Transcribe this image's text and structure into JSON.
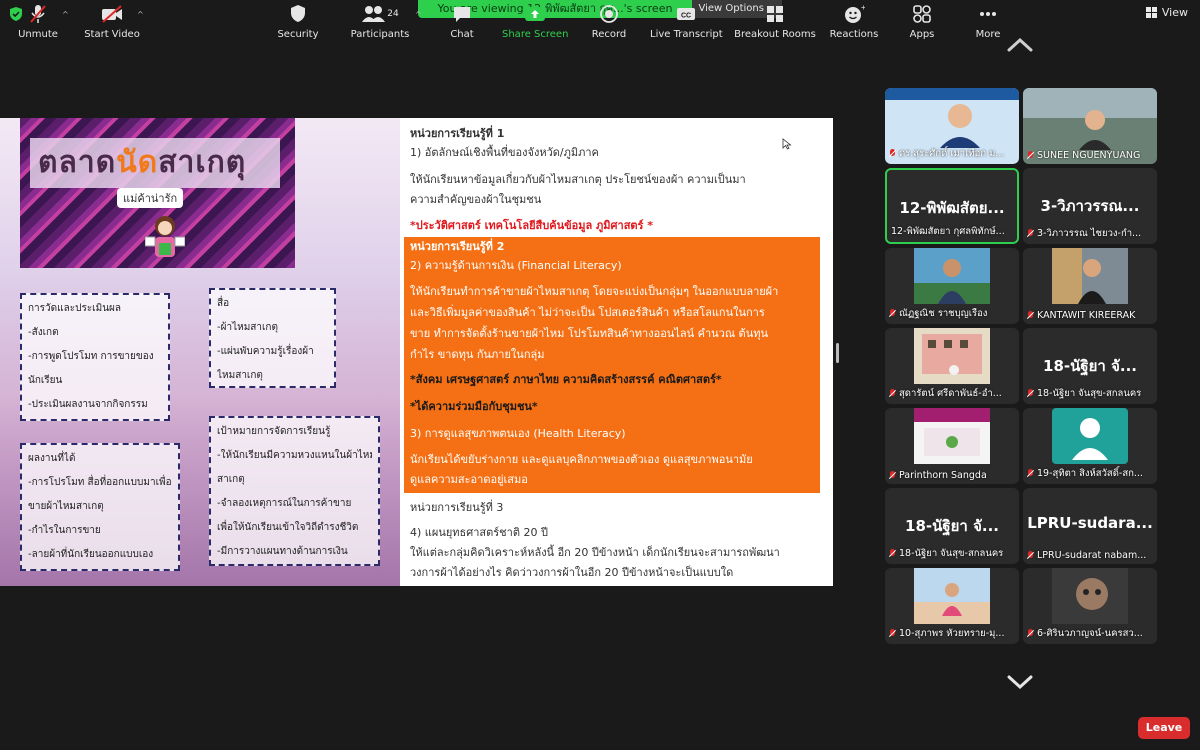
{
  "top": {
    "banner": "You are viewing 12-พิพัฒสัตยา กุศ...'s screen",
    "view_options": "View Options ⌄",
    "view_label": "View"
  },
  "slide": {
    "hero_title_a": "ตลาด",
    "hero_title_b": "นัด",
    "hero_title_c": "สาเกตุ",
    "hero_sub": "แม่ค้าน่ารัก",
    "box1": [
      "การวัดและประเมินผล",
      "-สังเกต",
      "-การพูดโปรโมท การขายของ",
      "นักเรียน",
      "-ประเมินผลงานจากกิจกรรม"
    ],
    "box2": [
      "สื่อ",
      "-ผ้าไหมสาเกตุ",
      "-แผ่นพับความรู้เรื่องผ้า",
      "ไหมสาเกตุ"
    ],
    "box3": [
      "ผลงานที่ได้",
      "-การโปรโมท สื่อที่ออกแบบมาเพื่อ",
      "ขายผ้าไหมสาเกตุ",
      "-กำไรในการขาย",
      "-ลายผ้าที่นักเรียนออกแบบเอง"
    ],
    "box4": [
      "เป้าหมายการจัดการเรียนรู้",
      "-ให้นักเรียนมีความหวงแหนในผ้าไหม",
      "สาเกตุ",
      "-จำลองเหตุการณ์ในการค้าขาย",
      "เพื่อให้นักเรียนเข้าใจวิถีดำรงชีวิต",
      "-มีการวางแผนทางด้านการเงิน"
    ],
    "unit1_title": "หน่วยการเรียนรู้ที่ 1",
    "unit1_sub": "1) อัตลักษณ์เชิงพื้นที่ของจังหวัด/ภูมิภาค",
    "unit1_p1": "ให้นักเรียนหาข้อมูลเกี่ยวกับผ้าไหมสาเกตุ ประโยชน์ของผ้า ความเป็นมา",
    "unit1_p2": "ความสำคัญของผ้าในชุมชน",
    "unit1_red": "*ประวัติศาสตร์ เทคโนโลยีสืบค้นข้อมูล ภูมิศาสตร์ *",
    "unit2_title": "หน่วยการเรียนรู้ที่ 2",
    "unit2_sub": "2) ความรู้ด้านการเงิน (Financial Literacy)",
    "unit2_lines": [
      "ให้นักเรียนทำการค้าขายผ้าไหมสาเกตุ โดยจะแบ่งเป็นกลุ่มๆ ในออกแบบลายผ้า",
      "และวิธีเพิ่มมูลค่าของสินค้า ไม่ว่าจะเป็น โปสเตอร์สินค้า หรือสโลแกนในการ",
      "ขาย ทำการจัดตั้งร้านขายผ้าไหม โปรโมทสินค้าทางออนไลน์ คำนวณ ต้นทุน",
      "กำไร ขาดทุน กันภายในกลุ่ม"
    ],
    "unit2_bold1": "*สังคม เศรษฐศาสตร์ ภาษาไทย ความคิดสร้างสรรค์ คณิตศาสตร์*",
    "unit2_bold2": "*ได้ความร่วมมือกับชุมชน*",
    "unit2_sub2": "3)  การดูแลสุขภาพตนเอง (Health Literacy)",
    "unit2_lines2": [
      "นักเรียนได้ขยับร่างกาย และดูแลบุคลิกภาพของตัวเอง ดูแลสุขภาพอนามัย",
      "ดูแลความสะอาดอยู่เสมอ"
    ],
    "unit3_title": "หน่วยการเรียนรู้ที่ 3",
    "unit3_sub": "4) แผนยุทธศาสตร์ชาติ 20 ปี",
    "unit3_p1": "ให้แต่ละกลุ่มคิดวิเคราะห์หลังนี้ อีก 20 ปีข้างหน้า เด็กนักเรียนจะสามารถพัฒนา",
    "unit3_p2": "วงการผ้าได้อย่างไร คิดว่าวงการผ้าในอีก 20 ปีข้างหน้าจะเป็นแบบใด"
  },
  "gallery": [
    {
      "name": "ดร.สุระศักดิ์ เมาเทือก ม...",
      "big": "",
      "type": "photo"
    },
    {
      "name": "SUNEE NGUENYUANG",
      "big": "",
      "type": "photo"
    },
    {
      "name": "12-พิพัฒสัตยา กุศลพิทักษ์...",
      "big": "12-พิพัฒสัตย...",
      "type": "text"
    },
    {
      "name": "3-วิภาวรรณ ไชยวง-กำ...",
      "big": "3-วิภาวรรณ...",
      "type": "text"
    },
    {
      "name": "ณัฏฐณิช ราชบุญเรือง",
      "big": "",
      "type": "photo"
    },
    {
      "name": "KANTAWIT KIREERAK",
      "big": "",
      "type": "photo"
    },
    {
      "name": "สุดารัตน์ ศรีดาพันธ์-อำ...",
      "big": "",
      "type": "photo"
    },
    {
      "name": "18-นัฐิยา จันสุข-สกลนคร",
      "big": "18-นัฐิยา จั...",
      "type": "text"
    },
    {
      "name": "Parinthorn Sangda",
      "big": "",
      "type": "photo"
    },
    {
      "name": "19-สุทิตา สิงห์สวัสดิ์-สก...",
      "big": "",
      "type": "avatar"
    },
    {
      "name": "18-นัฐิยา จันสุข-สกลนคร",
      "big": "18-นัฐิยา จั...",
      "type": "text"
    },
    {
      "name": "LPRU-sudarat nabam...",
      "big": "LPRU-sudara...",
      "type": "text"
    },
    {
      "name": "10-สุภาพร หัวยทราย-มุ...",
      "big": "",
      "type": "photo"
    },
    {
      "name": "6-ศิรินวภาญจน์-นครสว...",
      "big": "",
      "type": "photo"
    }
  ],
  "toolbar": {
    "unmute": "Unmute",
    "start_video": "Start Video",
    "security": "Security",
    "participants": "Participants",
    "participants_count": "24",
    "chat": "Chat",
    "share_screen": "Share Screen",
    "record": "Record",
    "live_transcript": "Live Transcript",
    "breakout_rooms": "Breakout Rooms",
    "reactions": "Reactions",
    "apps": "Apps",
    "more": "More",
    "leave": "Leave",
    "share_color": "#2fcf4e",
    "leave_color": "#d92c2c"
  }
}
